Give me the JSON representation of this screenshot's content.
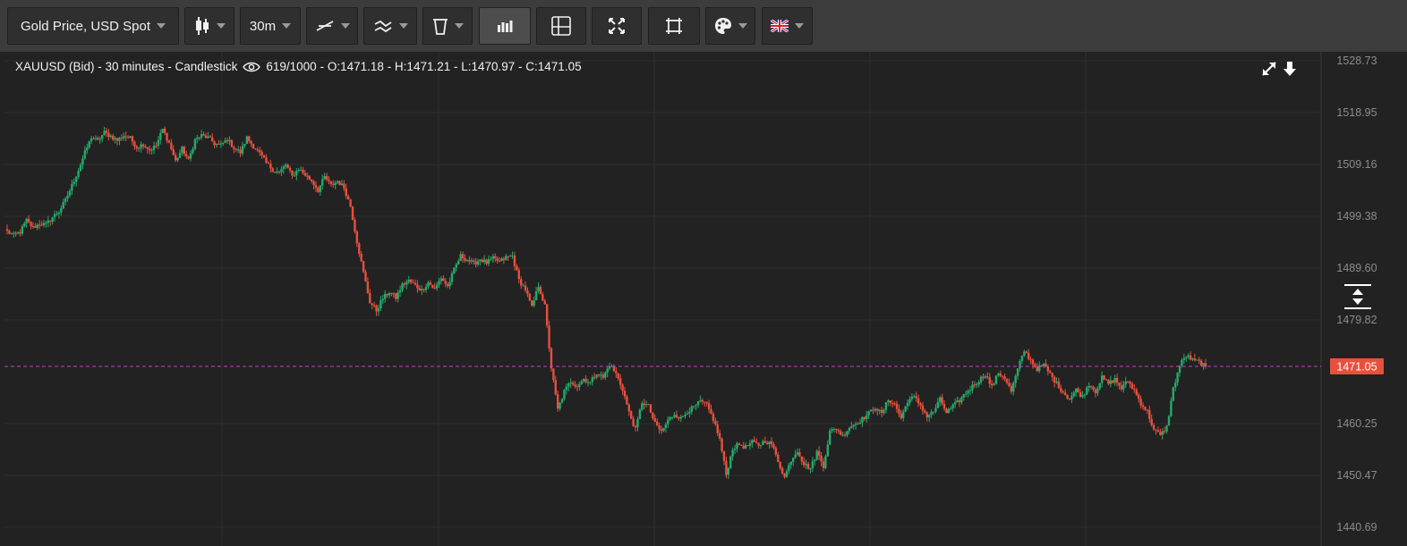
{
  "toolbar": {
    "instrument_label": "Gold Price, USD Spot",
    "interval_label": "30m",
    "icons": [
      "candlestick-type-icon",
      "indicator-line-icon",
      "drawing-tools-icon",
      "trash-icon",
      "volume-bars-icon",
      "crosshair-icon",
      "fullscreen-icon",
      "fit-chart-icon",
      "palette-icon",
      "uk-flag-icon"
    ]
  },
  "header": {
    "symbol_text": "XAUUSD (Bid) - 30 minutes - Candlestick",
    "count_text": "619/1000",
    "ohlc_text": "- O:1471.18 - H:1471.21 - L:1470.97 - C:1471.05"
  },
  "colors": {
    "up": "#26a96c",
    "down": "#e8503e",
    "current_price_line": "#c040c0",
    "price_tag": "#e8503e",
    "grid": "#2e2e2e"
  },
  "chart_data": {
    "type": "candlestick",
    "symbol": "XAUUSD",
    "interval": "30 minutes",
    "ylim": [
      1440.69,
      1528.73
    ],
    "yticks": [
      1528.73,
      1518.95,
      1509.16,
      1499.38,
      1489.6,
      1479.82,
      1460.25,
      1450.47,
      1440.69
    ],
    "current_price": 1471.05,
    "current_price_label": "1471.05",
    "close_path": [
      1496.5,
      1495.8,
      1496.4,
      1498.6,
      1497.2,
      1498.0,
      1497.8,
      1499.2,
      1500.3,
      1502.4,
      1505.2,
      1508.1,
      1511.4,
      1514.3,
      1513.6,
      1515.2,
      1514.5,
      1513.7,
      1514.6,
      1514.1,
      1512.4,
      1513.0,
      1511.9,
      1512.7,
      1515.8,
      1513.2,
      1509.8,
      1512.1,
      1509.9,
      1513.8,
      1514.6,
      1514.2,
      1513.1,
      1512.8,
      1513.9,
      1512.3,
      1511.4,
      1514.2,
      1512.6,
      1511.2,
      1509.4,
      1508.2,
      1507.6,
      1509.1,
      1506.9,
      1508.4,
      1507.2,
      1506.1,
      1504.3,
      1506.8,
      1505.2,
      1506.0,
      1504.8,
      1501.3,
      1494.6,
      1488.7,
      1483.2,
      1481.6,
      1483.9,
      1485.1,
      1484.0,
      1486.4,
      1487.2,
      1486.3,
      1485.4,
      1486.9,
      1485.6,
      1487.8,
      1486.1,
      1489.3,
      1491.9,
      1491.2,
      1490.4,
      1491.3,
      1490.6,
      1491.4,
      1490.8,
      1491.6,
      1491.9,
      1487.3,
      1485.6,
      1482.1,
      1486.3,
      1482.4,
      1470.8,
      1462.9,
      1466.3,
      1468.2,
      1467.4,
      1468.7,
      1468.0,
      1469.9,
      1468.9,
      1471.4,
      1469.6,
      1466.8,
      1462.3,
      1459.1,
      1464.3,
      1463.5,
      1460.2,
      1458.7,
      1460.8,
      1462.1,
      1461.2,
      1462.6,
      1463.3,
      1464.4,
      1463.7,
      1461.1,
      1457.3,
      1450.6,
      1455.6,
      1456.3,
      1455.8,
      1456.7,
      1456.2,
      1457.0,
      1456.4,
      1453.2,
      1450.1,
      1453.4,
      1455.2,
      1452.6,
      1451.8,
      1454.9,
      1452.3,
      1458.7,
      1459.3,
      1457.9,
      1459.6,
      1460.3,
      1461.1,
      1462.2,
      1463.4,
      1462.0,
      1464.8,
      1463.9,
      1461.3,
      1464.6,
      1465.2,
      1463.7,
      1461.6,
      1462.5,
      1464.8,
      1462.3,
      1463.5,
      1464.6,
      1466.1,
      1467.3,
      1468.4,
      1469.6,
      1467.1,
      1469.8,
      1468.9,
      1466.3,
      1470.5,
      1474.0,
      1472.2,
      1470.6,
      1471.3,
      1469.6,
      1467.8,
      1466.2,
      1464.9,
      1466.6,
      1465.3,
      1467.8,
      1466.4,
      1468.9,
      1467.8,
      1468.6,
      1466.9,
      1468.3,
      1466.5,
      1464.1,
      1462.5,
      1459.1,
      1458.0,
      1459.6,
      1466.8,
      1471.3,
      1473.1,
      1472.2,
      1471.9,
      1471.05
    ]
  }
}
